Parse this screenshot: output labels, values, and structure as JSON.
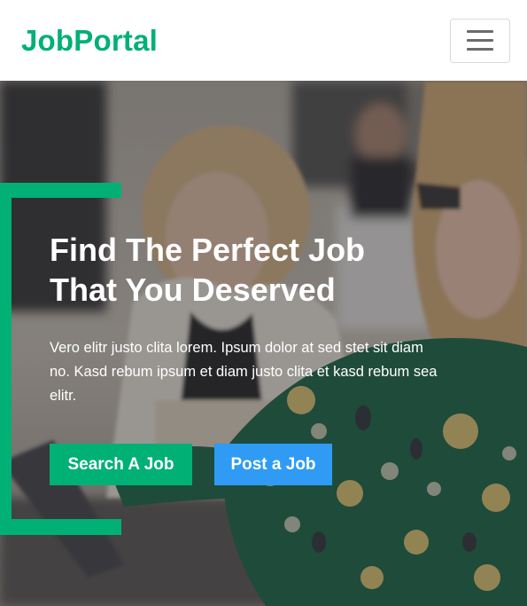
{
  "navbar": {
    "brand": "JobPortal",
    "menu_icon": "hamburger-menu-icon"
  },
  "hero": {
    "title_line1": "Find The Perfect Job",
    "title_line2": "That You Deserved",
    "description": "Vero elitr justo clita lorem. Ipsum dolor at sed stet sit diam no. Kasd rebum ipsum et diam justo clita et kasd rebum sea elitr.",
    "buttons": [
      {
        "label": "Search A Job"
      },
      {
        "label": "Post a Job"
      }
    ]
  },
  "colors": {
    "primary": "#00B074",
    "secondary": "#2F9BF5",
    "overlay": "rgba(30,32,36,0.42)"
  }
}
